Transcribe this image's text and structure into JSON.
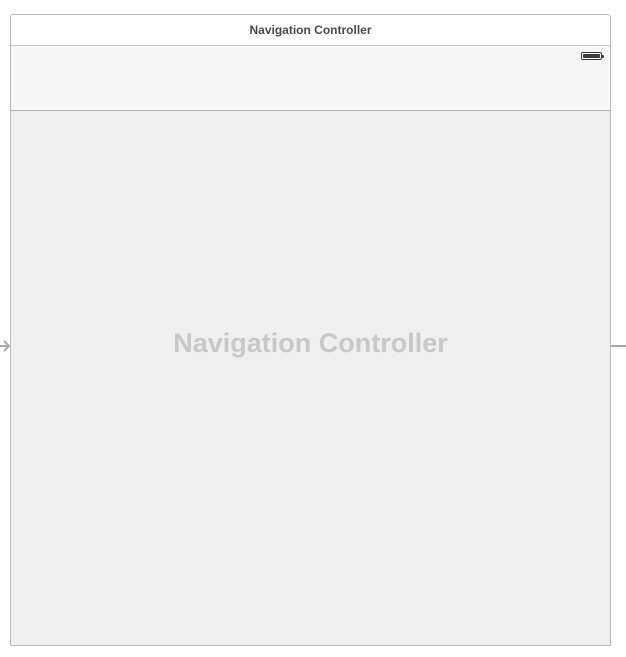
{
  "scene": {
    "title": "Navigation Controller",
    "placeholder": "Navigation Controller"
  },
  "icons": {
    "battery": "battery-icon",
    "entry_arrow": "entry-point-arrow-icon"
  },
  "colors": {
    "frame_border": "#b9b9b9",
    "title_text": "#4a4a4a",
    "content_background": "#efefef",
    "placeholder_text": "#c8c8c8",
    "connector": "#a8a8a8"
  }
}
